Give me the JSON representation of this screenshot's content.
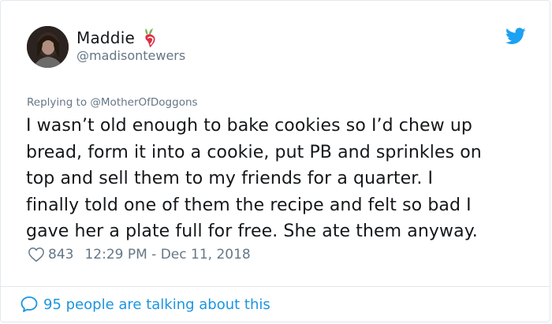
{
  "user": {
    "display_name": "Maddie",
    "handle": "@madisontewers",
    "emoji_icon": "radish-emoji-icon"
  },
  "reply": {
    "prefix": "Replying to ",
    "mention": "@MotherOfDoggons"
  },
  "tweet": {
    "lines": [
      "I wasn’t old enough to bake cookies so I’d chew up",
      "bread, form it into a cookie, put PB and sprinkles on",
      "top and sell them to my friends for a quarter. I",
      "finally told one of them the recipe and felt so bad I",
      "gave her a plate full for free. She ate them anyway."
    ]
  },
  "meta": {
    "like_count": "843",
    "timestamp": "12:29 PM - Dec 11, 2018"
  },
  "footer": {
    "talking_text": "95 people are talking about this"
  },
  "colors": {
    "link_blue": "#1b95e0",
    "twitter_blue": "#1da1f2",
    "muted_gray": "#657786",
    "text": "#14171a",
    "border": "#e1e8ed"
  }
}
